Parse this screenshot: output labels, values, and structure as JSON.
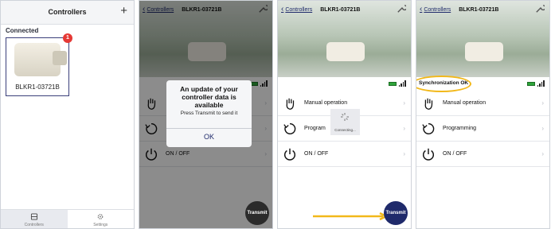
{
  "colors": {
    "accent": "#1f2a6b",
    "badge": "#e53935",
    "battery": "#2ea43a",
    "highlight": "#f2b81a"
  },
  "screen1": {
    "title": "Controllers",
    "add_icon": "plus-icon",
    "section_label": "Connected",
    "device": {
      "name": "BLKR1-03721B",
      "badge_count": "1"
    },
    "tabs": [
      {
        "label": "Controllers",
        "icon": "controller-icon"
      },
      {
        "label": "Settings",
        "icon": "gear-icon"
      }
    ]
  },
  "screen2": {
    "back_label": "Controllers",
    "title": "BLKR1-03721B",
    "dialog": {
      "title": "An update of your controller data is available",
      "message": "Press Transmit to send it",
      "ok_label": "OK"
    },
    "menu": [
      {
        "label": "",
        "icon": "hand-icon"
      },
      {
        "label": "",
        "icon": "refresh-icon"
      },
      {
        "label": "ON / OFF",
        "icon": "power-icon"
      }
    ],
    "transmit_label": "Transmit"
  },
  "screen3": {
    "back_label": "Controllers",
    "title": "BLKR1-03721B",
    "menu": [
      {
        "label": "Manual operation",
        "icon": "hand-icon"
      },
      {
        "label": "Program",
        "icon": "refresh-icon"
      },
      {
        "label": "ON / OFF",
        "icon": "power-icon"
      }
    ],
    "loading_label": "Connecting...",
    "transmit_label": "Transmit"
  },
  "screen4": {
    "back_label": "Controllers",
    "title": "BLKR1-03721B",
    "sync_label": "Synchronization OK",
    "menu": [
      {
        "label": "Manual operation",
        "icon": "hand-icon"
      },
      {
        "label": "Programming",
        "icon": "refresh-icon"
      },
      {
        "label": "ON / OFF",
        "icon": "power-icon"
      }
    ]
  }
}
